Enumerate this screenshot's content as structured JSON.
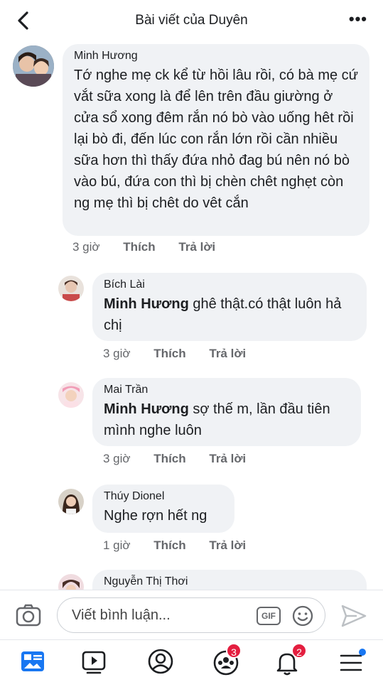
{
  "header": {
    "title": "Bài viết của Duyên",
    "more_label": "•••"
  },
  "comments": [
    {
      "name": "Minh Hương",
      "text": "Tớ nghe mẹ ck kể từ hồi lâu rồi, có bà mẹ cứ vắt sữa xong là để lên trên đầu giường ở cửa sổ xong đêm rắn nó bò vào uống hêt rồi lại bò đi, đến lúc con rắn lớn rồi cần nhiều sữa hơn thì thấy đứa nhỏ đag bú nên nó bò vào bú, đứa con thì bị chèn chêt nghẹt còn ng mẹ thì bị chêt do vêt cắn",
      "time": "3 giờ",
      "like": "Thích",
      "reply": "Trả lời"
    },
    {
      "name": "Bích Lài",
      "mention": "Minh Hương",
      "text": " ghê thật.có thật luôn hả chị",
      "time": "3 giờ",
      "like": "Thích",
      "reply": "Trả lời"
    },
    {
      "name": "Mai Trần",
      "mention": "Minh Hương",
      "text": " sợ thế m, lần đầu tiên mình nghe luôn",
      "time": "3 giờ",
      "like": "Thích",
      "reply": "Trả lời"
    },
    {
      "name": "Thúy Dionel",
      "text": "Nghe rợn hết ng",
      "time": "1 giờ",
      "like": "Thích",
      "reply": "Trả lời"
    },
    {
      "name": "Nguyễn Thị Thơi"
    }
  ],
  "composer": {
    "placeholder": "Viết bình luận...",
    "gif_label": "GIF"
  },
  "tabbar": {
    "groups_badge": "3",
    "notifications_badge": "2"
  },
  "colors": {
    "accent": "#1877f2",
    "badge": "#e41e3f",
    "bubble": "#f0f2f5"
  }
}
